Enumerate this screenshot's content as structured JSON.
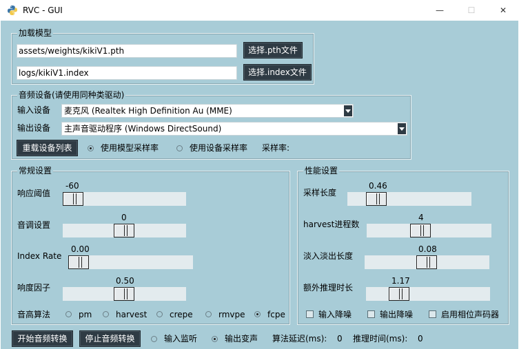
{
  "window": {
    "title": "RVC - GUI",
    "min_glyph": "—",
    "max_glyph": "☐",
    "close_glyph": "✕"
  },
  "load_model": {
    "group_label": "加载模型",
    "pth_path": "assets/weights/kikiV1.pth",
    "pth_button": "选择.pth文件",
    "index_path": "logs/kikiV1.index",
    "index_button": "选择.index文件"
  },
  "audio_device": {
    "group_label": "音频设备(请使用同种类驱动)",
    "input_label": "输入设备",
    "input_value": "麦克风 (Realtek High Definition Au (MME)",
    "output_label": "输出设备",
    "output_value": "主声音驱动程序 (Windows DirectSound)",
    "reload_button": "重载设备列表",
    "radio_model_rate": "使用模型采样率",
    "radio_device_rate": "使用设备采样率",
    "sample_rate_label": "采样率:",
    "selected_rate_mode": "model"
  },
  "general": {
    "group_label": "常规设置",
    "threshold": {
      "label": "响应阈值",
      "value": "-60",
      "fraction": 0.02
    },
    "pitch": {
      "label": "音调设置",
      "value": "0",
      "fraction": 0.5
    },
    "index_rate": {
      "label": "Index Rate",
      "value": "0.00",
      "fraction": 0.0
    },
    "rms_mix": {
      "label": "响度因子",
      "value": "0.50",
      "fraction": 0.5
    },
    "f0_label": "音高算法",
    "f0_methods": [
      "pm",
      "harvest",
      "crepe",
      "rmvpe",
      "fcpe"
    ],
    "f0_selected": "fcpe"
  },
  "performance": {
    "group_label": "性能设置",
    "block_time": {
      "label": "采样长度",
      "value": "0.46",
      "fraction": 0.15
    },
    "n_cpu": {
      "label": "harvest进程数",
      "value": "4",
      "fraction": 0.5
    },
    "crossfade": {
      "label": "淡入淡出长度",
      "value": "0.08",
      "fraction": 0.5
    },
    "extra_time": {
      "label": "额外推理时长",
      "value": "1.17",
      "fraction": 0.24
    },
    "noise_in": "输入降噪",
    "noise_out": "输出降噪",
    "phase_vocoder": "启用相位声码器"
  },
  "bottom": {
    "start_button": "开始音频转换",
    "stop_button": "停止音频转换",
    "radio_input_monitor": "输入监听",
    "radio_output_voice": "输出变声",
    "selected_function": "output",
    "delay_label": "算法延迟(ms):",
    "delay_value": "0",
    "infer_label": "推理时间(ms):",
    "infer_value": "0"
  },
  "colors": {
    "background": "#a8ccd7",
    "button_dark": "#2f3b44"
  }
}
